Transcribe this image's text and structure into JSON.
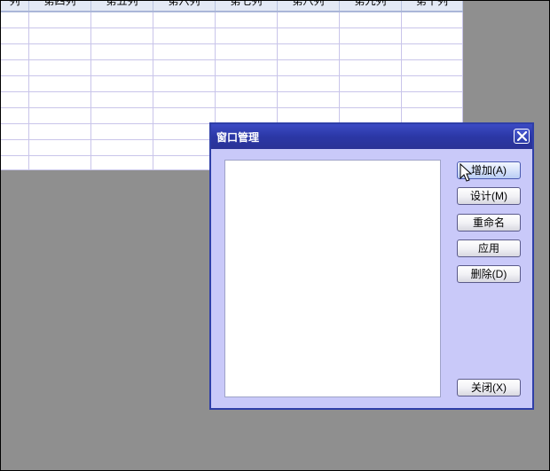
{
  "sheet": {
    "columns": [
      "列",
      "第四列",
      "第五列",
      "第六列",
      "第七列",
      "第八列",
      "第九列",
      "第十列"
    ]
  },
  "dialog": {
    "title": "窗口管理",
    "buttons": {
      "add": "增加(A)",
      "design": "设计(M)",
      "rename": "重命名",
      "apply": "应用",
      "delete": "删除(D)",
      "close": "关闭(X)"
    }
  },
  "icons": {
    "close": "close-icon",
    "cursor": "mouse-cursor-icon"
  },
  "colors": {
    "titlebar": "#2b37a6",
    "dialog_bg": "#c9c9f9",
    "desktop": "#8f8f8f"
  }
}
